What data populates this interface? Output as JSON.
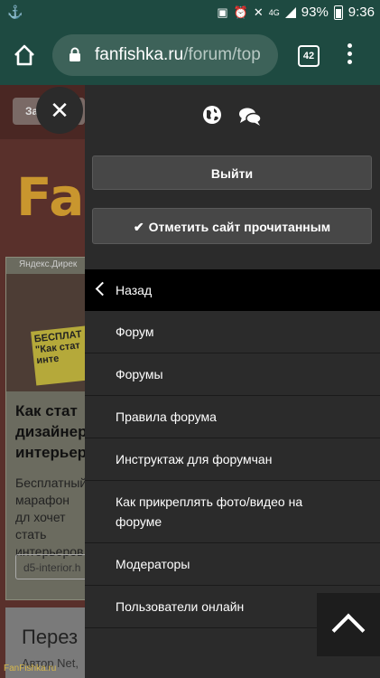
{
  "statusbar": {
    "battery": "93%",
    "time": "9:36",
    "network": "4G"
  },
  "browser": {
    "domain": "fanfishka.ru",
    "path": "/forum/top",
    "tab_count": "42"
  },
  "background": {
    "chip": "За",
    "logo": "Fa",
    "ad_label": "Яндекс.Дирек",
    "ad_sign": "БЕСПЛАТ \"Как стат инте",
    "ad_title": "Как стат дизайнер интерьер",
    "ad_text": "Бесплатный марафон дл хочет стать интерьеров",
    "ad_link": "d5-interior.h",
    "post_title": "Перез",
    "post_sub": "Автор Net,",
    "footer": "FanFishka.ru"
  },
  "panel": {
    "logout": "Выйти",
    "mark_read": "Отметить сайт прочитанным",
    "menu": {
      "back": "Назад",
      "items": [
        "Форум",
        "Форумы",
        "Правила форума",
        "Инструктаж для форумчан",
        "Как прикреплять фото/видео на форуме",
        "Модераторы",
        "Пользователи онлайн"
      ]
    }
  },
  "colors": {
    "toolbar": "#1e4a41",
    "panel": "#2b2b2b",
    "button": "#474747"
  }
}
